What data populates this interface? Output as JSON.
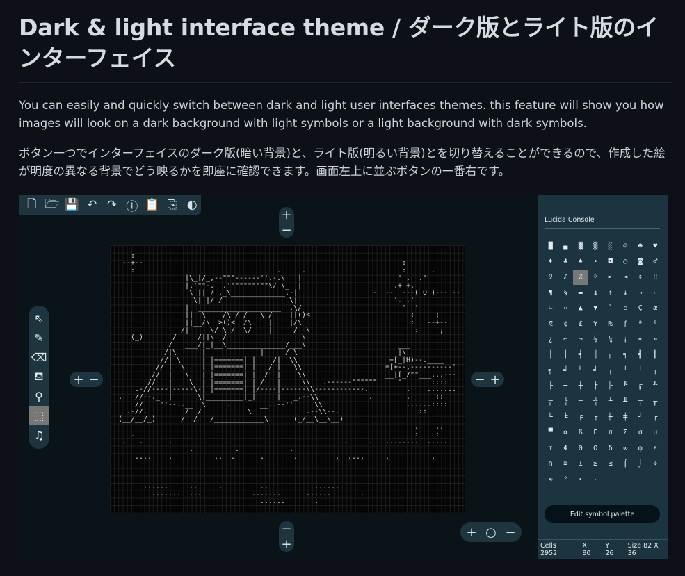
{
  "title": "Dark & light interface theme / ダーク版とライト版のインターフェイス",
  "paragraphs": [
    "You can easily and quickly switch between dark and light user interfaces themes. this feature will show you how images will look on a dark background with light symbols or a light background with dark symbols.",
    "ボタン一つでインターフェイスのダーク版(暗い背景)と、ライト版(明るい背景)とを切り替えることができるので、作成した絵が明度の異なる背景でどう映るかを即座に確認できます。画面左上に並ぶボタンの一番右です。"
  ],
  "toolbar": [
    {
      "name": "new-file-icon",
      "glyph": "🗋"
    },
    {
      "name": "open-folder-icon",
      "glyph": "🗁"
    },
    {
      "name": "save-icon",
      "glyph": "💾"
    },
    {
      "name": "undo-icon",
      "glyph": "↶"
    },
    {
      "name": "redo-icon",
      "glyph": "↷"
    },
    {
      "name": "info-icon",
      "glyph": "ⓘ"
    },
    {
      "name": "paste-icon",
      "glyph": "📋"
    },
    {
      "name": "export-icon",
      "glyph": "⎘"
    },
    {
      "name": "theme-toggle-icon",
      "glyph": "◐"
    }
  ],
  "zoom_controls": {
    "plus": "+",
    "minus": "−",
    "reset": "○"
  },
  "tools": [
    {
      "name": "select-arrow-icon",
      "glyph": "⇖",
      "selected": false
    },
    {
      "name": "pencil-icon",
      "glyph": "✎",
      "selected": false
    },
    {
      "name": "eraser-icon",
      "glyph": "⌫",
      "selected": false
    },
    {
      "name": "fill-bucket-icon",
      "glyph": "⛾",
      "selected": false
    },
    {
      "name": "eyedropper-icon",
      "glyph": "⚲",
      "selected": false
    },
    {
      "name": "rect-select-icon",
      "glyph": "⬚",
      "selected": true
    },
    {
      "name": "music-note-icon",
      "glyph": "♫",
      "selected": false
    }
  ],
  "canvas_art": [
    "",
    "     :                                                                              ",
    "   --+--                                                              :              ",
    "     :                                  ._____.                       :      .       ",
    "                  |\\_|/_,--\"\"\"------''.-.\\   |                       ' .  .'       ",
    "                  |.'\"\"-.  .'\"\"\"\"\"\"\"\"\"\\/ \\_  |                      .+ +.         ",
    "                   \\ || / ._\\_____________.-|                  -  --  ---( O )--- --  -",
    "                  __\\|_|/_/________________\\|___                    '. .'           ",
    "                  |  ____________________  .\\/                        '  '         ",
    "                  ||  \\    /\\ / /   \\ /    ||()<                        :     ;    ",
    "                  ||__/\\  >()<  /\\    |    |/\\                          :   --+--  ",
    "                 /|_____\\/_\\_/__\\/____|_____/  \\                         :     ;    ",
    "     (_)       /     /||\\  /                  \\                                     ",
    "              /   ___/|_|__\\______________/___\\                      ___             ",
    "             /|\\      |  _________  |     / \\                        |\\_             ",
    "            //| \\     | |=======| |    /|  \\\\                      =[_|H)--.____   ",
    "           // |  \\    | |=======| |   / |   \\\\                    =[+--,----------' ",
    "          //  |   \\   | |=======| |  /  |    \\\\                   __|[_/\"\"___...---",
    "         //   |    \\  | |=======| | /   |     \\\\___.------\"\"\"\"\"\"     '       ::::",
    "  ____.-//----|-----\\-|_|=======|_|/----|------\\\\------------.         .    .......",
    "  .   //--._  |      \\|_________|_|     |   _.--\\\\            .        .      ::   ",
    "      //    ''--..__  \\     .       __..--''     \\\\                    ......::::  ",
    "   _.-//._        /  /   ________\\____        _.--\\\\--._                  ::       ",
    "  (__/__/_)      /  /   /____________\\      (_/__\\__\\__)                           ",
    "                                                                         .    ..   ",
    "     .                                                                   :    :    ",
    "   .   .      .                                         .     .   ........  ..... ",
    "                   .          .            .                                      ",
    "      ....    .          ..  .      .       .         .  ....     .          .   ",
    "                                                                                  ",
    "                                                                                  ",
    "                                                                                  ",
    "        ......     ..     .         ..           ......                          ",
    "          .......  ...            .......      ......       .                    ",
    "                                    ......       .                               "
  ],
  "symbol_panel": {
    "font_name": "Lucida Console",
    "symbols": [
      "█",
      "▄",
      "▓",
      "▒",
      "░",
      "☺",
      "☻",
      "♥",
      "♦",
      "♣",
      "♠",
      "•",
      "◘",
      "○",
      "◙",
      "♂",
      "♀",
      "♪",
      "♫",
      "☼",
      "►",
      "◄",
      "↕",
      "‼",
      "¶",
      "§",
      "▬",
      "↨",
      "↑",
      "↓",
      "→",
      "←",
      "∟",
      "↔",
      "▲",
      "▼",
      "`",
      "⌂",
      "Ç",
      "æ",
      "Æ",
      "¢",
      "£",
      "¥",
      "₧",
      "ƒ",
      "ª",
      "º",
      "¿",
      "⌐",
      "¬",
      "½",
      "¼",
      "¡",
      "«",
      "»",
      "│",
      "┤",
      "╡",
      "╢",
      "╖",
      "╕",
      "╣",
      "║",
      "╗",
      "╝",
      "╜",
      "╛",
      "┐",
      "└",
      "┴",
      "┬",
      "├",
      "─",
      "┼",
      "╞",
      "╟",
      "╚",
      "╔",
      "╩",
      "╦",
      "╠",
      "═",
      "╬",
      "╧",
      "╨",
      "╤",
      "╥",
      "╙",
      "╘",
      "╒",
      "╓",
      "╫",
      "╪",
      "┘",
      "┌",
      "▀",
      "α",
      "ß",
      "Γ",
      "π",
      "Σ",
      "σ",
      "µ",
      "τ",
      "Φ",
      "Θ",
      "Ω",
      "δ",
      "∞",
      "φ",
      "ε",
      "∩",
      "≡",
      "±",
      "≥",
      "≤",
      "⌠",
      "⌡",
      "÷",
      "≈",
      "°",
      "∙",
      "·"
    ],
    "selected_symbol": "♫",
    "edit_button": "Edit symbol palette"
  },
  "status": {
    "cells": "Cells 2952",
    "x": "X 80",
    "y": "Y 26",
    "size": "Size 82 X 36"
  }
}
